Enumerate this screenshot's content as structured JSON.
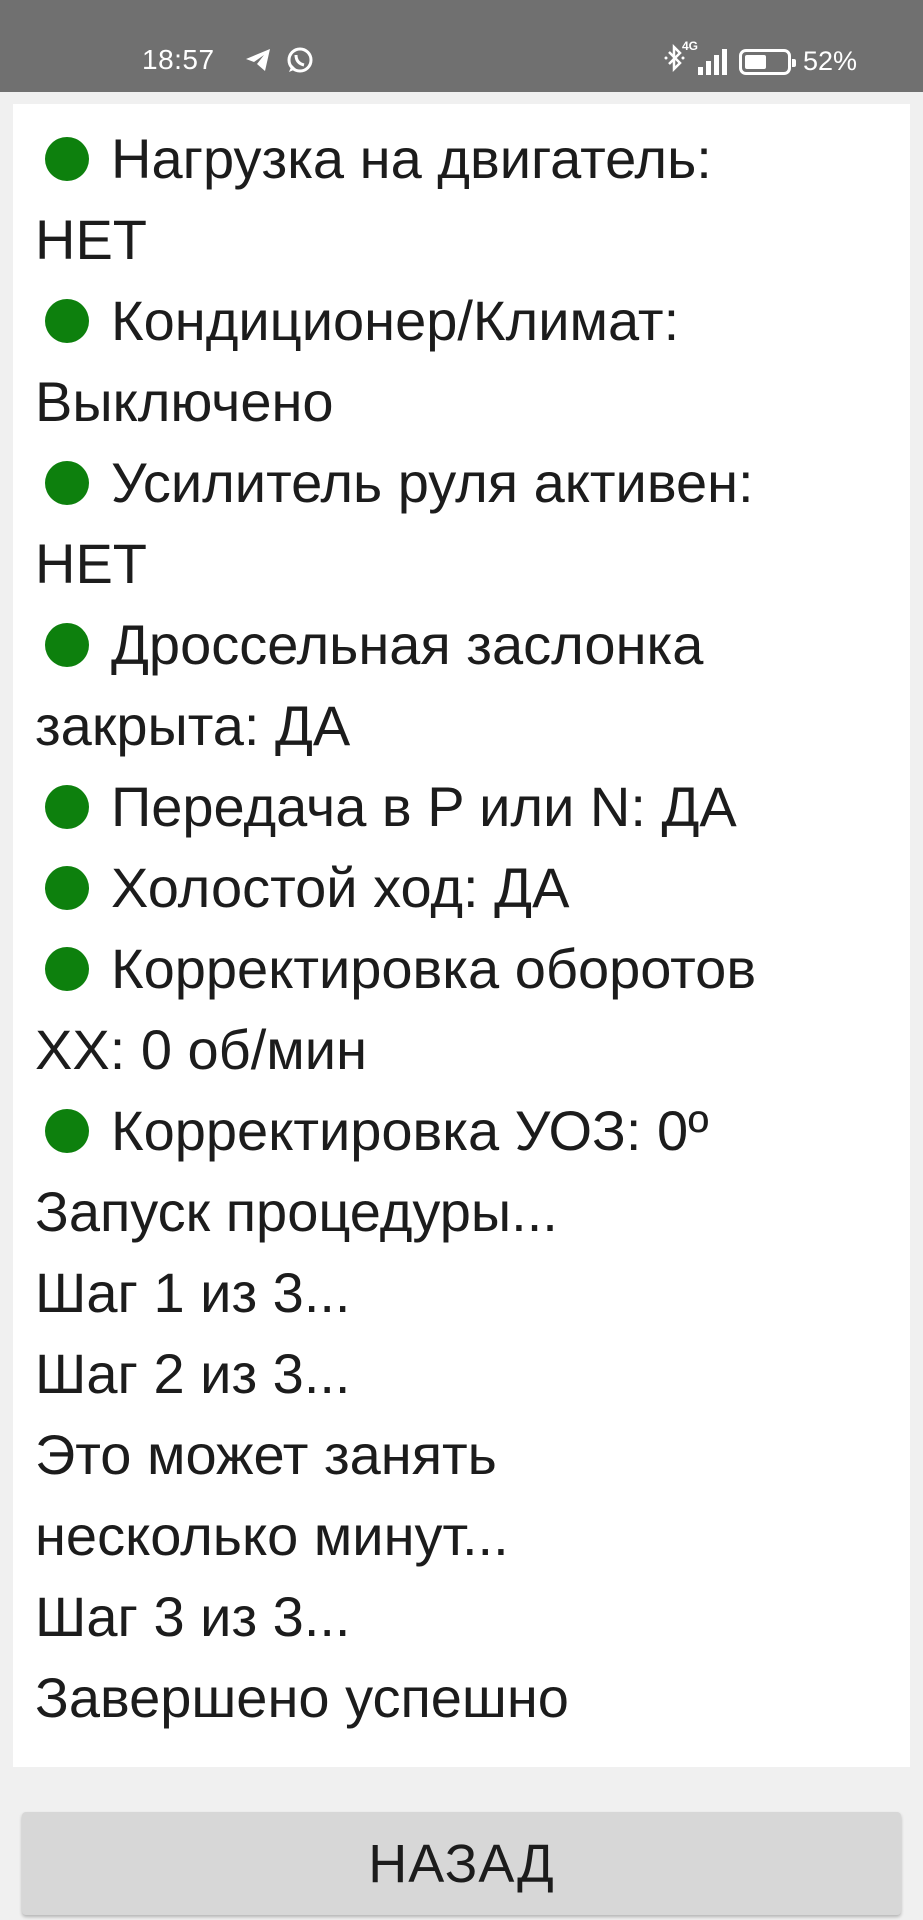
{
  "status_bar": {
    "time": "18:57",
    "left_icons": [
      "telegram-icon",
      "whatsapp-icon"
    ],
    "network_label": "4G",
    "battery_text": "52%",
    "battery_level": 0.52
  },
  "log": {
    "indicator_color": "#0d800d",
    "lines": [
      {
        "text": "Нагрузка на двигатель:",
        "dot": true
      },
      {
        "text": "НЕТ",
        "dot": false
      },
      {
        "text": "Кондиционер/Климат:",
        "dot": true
      },
      {
        "text": "Выключено",
        "dot": false
      },
      {
        "text": "Усилитель руля активен:",
        "dot": true
      },
      {
        "text": "НЕТ",
        "dot": false
      },
      {
        "text": "Дроссельная заслонка",
        "dot": true
      },
      {
        "text": "закрыта: ДА",
        "dot": false
      },
      {
        "text": "Передача в P или N: ДА",
        "dot": true
      },
      {
        "text": "Холостой ход: ДА",
        "dot": true
      },
      {
        "text": "Корректировка оборотов",
        "dot": true
      },
      {
        "text": "ХХ: 0 об/мин",
        "dot": false
      },
      {
        "text": "Корректировка УОЗ: 0º",
        "dot": true
      },
      {
        "text": "Запуск процедуры...",
        "dot": false
      },
      {
        "text": "Шаг 1 из 3...",
        "dot": false
      },
      {
        "text": "Шаг 2 из 3...",
        "dot": false
      },
      {
        "text": "Это может занять",
        "dot": false
      },
      {
        "text": "несколько минут...",
        "dot": false
      },
      {
        "text": "Шаг 3 из 3...",
        "dot": false
      },
      {
        "text": "Завершено успешно",
        "dot": false
      }
    ]
  },
  "back_button": {
    "label": "НАЗАД"
  }
}
